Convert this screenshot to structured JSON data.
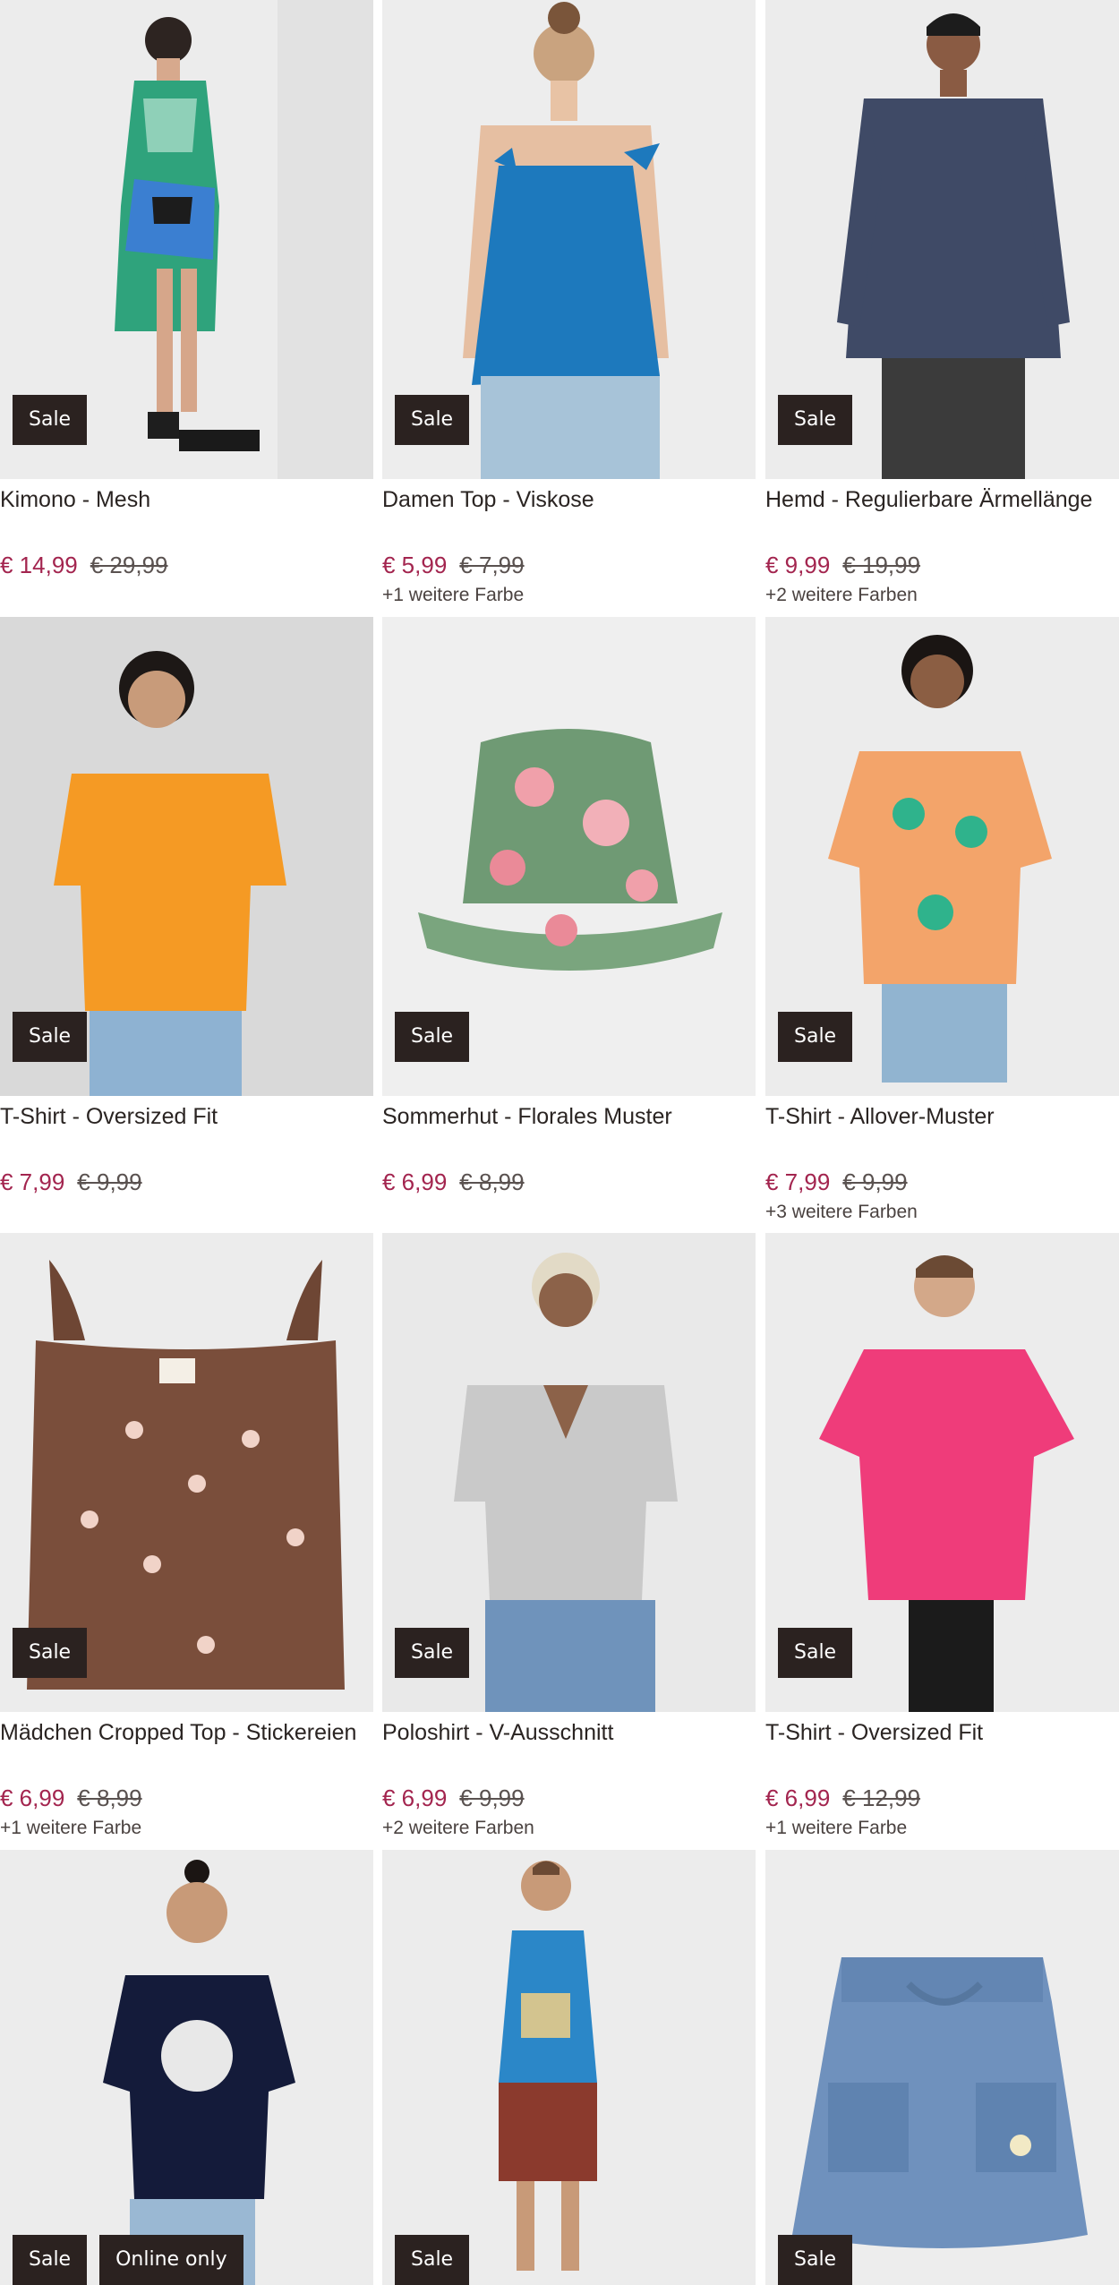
{
  "products": [
    {
      "title": "Kimono - Mesh",
      "price": "€ 14,99",
      "old_price": "€ 29,99",
      "colors": "",
      "badges": [
        "Sale"
      ]
    },
    {
      "title": "Damen Top - Viskose",
      "price": "€ 5,99",
      "old_price": "€ 7,99",
      "colors": "+1 weitere Farbe",
      "badges": [
        "Sale"
      ]
    },
    {
      "title": "Hemd - Regulierbare Ärmellänge",
      "price": "€ 9,99",
      "old_price": "€ 19,99",
      "colors": "+2 weitere Farben",
      "badges": [
        "Sale"
      ]
    },
    {
      "title": "T-Shirt - Oversized Fit",
      "price": "€ 7,99",
      "old_price": "€ 9,99",
      "colors": "",
      "badges": [
        "Sale"
      ]
    },
    {
      "title": "Sommerhut - Florales Muster",
      "price": "€ 6,99",
      "old_price": "€ 8,99",
      "colors": "",
      "badges": [
        "Sale"
      ]
    },
    {
      "title": "T-Shirt - Allover-Muster",
      "price": "€ 7,99",
      "old_price": "€ 9,99",
      "colors": "+3 weitere Farben",
      "badges": [
        "Sale"
      ]
    },
    {
      "title": "Mädchen Cropped Top - Stickereien",
      "price": "€ 6,99",
      "old_price": "€ 8,99",
      "colors": "+1 weitere Farbe",
      "badges": [
        "Sale"
      ]
    },
    {
      "title": "Poloshirt - V-Ausschnitt",
      "price": "€ 6,99",
      "old_price": "€ 9,99",
      "colors": "+2 weitere Farben",
      "badges": [
        "Sale"
      ]
    },
    {
      "title": "T-Shirt - Oversized Fit",
      "price": "€ 6,99",
      "old_price": "€ 12,99",
      "colors": "+1 weitere Farbe",
      "badges": [
        "Sale"
      ]
    },
    {
      "title": "",
      "price": "",
      "old_price": "",
      "colors": "",
      "badges": [
        "Sale",
        "Online only"
      ]
    },
    {
      "title": "",
      "price": "",
      "old_price": "",
      "colors": "",
      "badges": [
        "Sale"
      ]
    },
    {
      "title": "",
      "price": "",
      "old_price": "",
      "colors": "",
      "badges": [
        "Sale"
      ]
    }
  ],
  "icons": [
    "kimono-image",
    "top-image",
    "shirt-image",
    "tshirt-image",
    "hat-image",
    "tshirt-image",
    "crop-top-image",
    "polo-image",
    "tshirt-image",
    "tshirt-image",
    "tank-image",
    "skirt-image"
  ],
  "colors": {
    "price": "#a3254f",
    "badge": "#2b2220",
    "image_bg": "#ebebeb"
  }
}
